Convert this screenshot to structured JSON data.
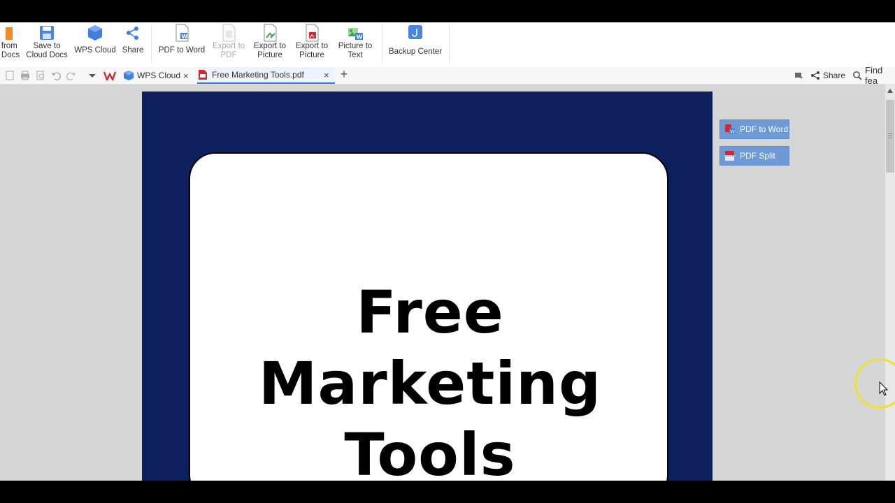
{
  "ribbon": {
    "buttons": [
      {
        "label": "from\nDocs",
        "icon": "docs-icon",
        "enabled": true
      },
      {
        "label": "Save to\nCloud Docs",
        "icon": "save-cloud-icon",
        "enabled": true
      },
      {
        "label": "WPS Cloud",
        "icon": "wps-cloud-icon",
        "enabled": true
      },
      {
        "label": "Share",
        "icon": "share-icon",
        "enabled": true
      },
      {
        "label": "PDF to Word",
        "icon": "pdf-to-word-icon",
        "enabled": true
      },
      {
        "label": "Export to\nPDF",
        "icon": "export-pdf-icon",
        "enabled": false
      },
      {
        "label": "Export to\nPicture",
        "icon": "export-picture-icon",
        "enabled": true
      },
      {
        "label": "Export to\nPicture",
        "icon": "export-picture-icon",
        "enabled": true
      },
      {
        "label": "Picture to\nText",
        "icon": "picture-to-text-icon",
        "enabled": true
      },
      {
        "label": "Backup Center",
        "icon": "backup-center-icon",
        "enabled": true
      }
    ]
  },
  "tabs": {
    "items": [
      {
        "label": "WPS Cloud",
        "icon": "wps-cloud-icon",
        "active": false
      },
      {
        "label": "Free Marketing Tools.pdf",
        "icon": "pdf-file-icon",
        "active": true
      }
    ],
    "close_glyph": "×",
    "add_glyph": "+"
  },
  "right_tools": {
    "share_label": "Share",
    "find_label": "Find fea"
  },
  "document": {
    "title_line1": "Free Marketing",
    "title_line2": "Tools"
  },
  "side_actions": {
    "pdf_to_word": "PDF to Word",
    "pdf_split": "PDF Split"
  },
  "colors": {
    "accent": "#3a78d6",
    "page_background": "#0d1f5c",
    "side_button": "#6e9ad6",
    "brand_red": "#d9262b"
  }
}
